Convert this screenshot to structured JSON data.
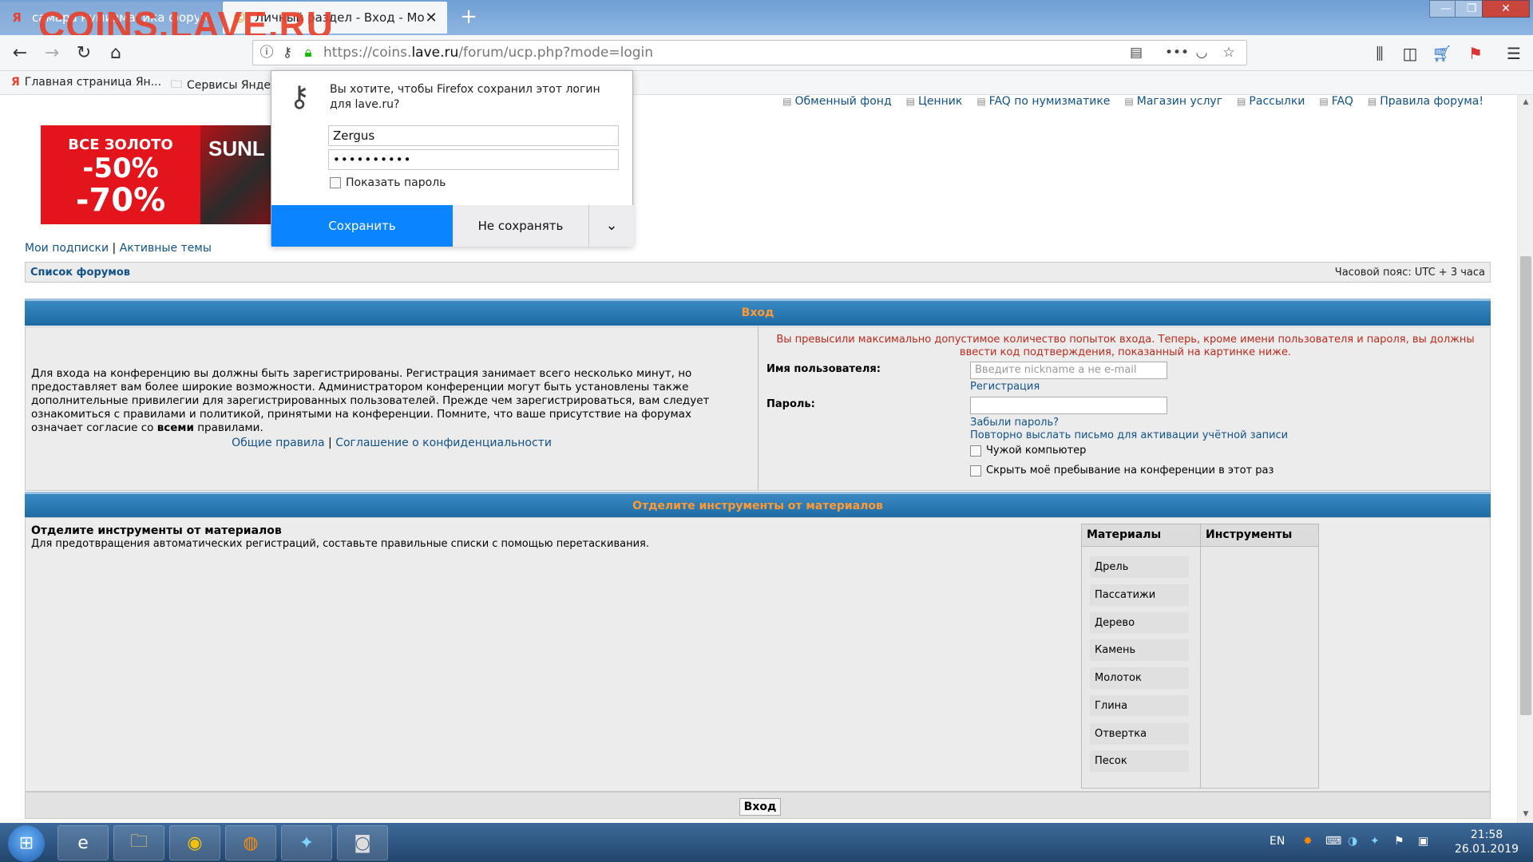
{
  "window": {
    "watermark": "COINS.LAVE.RU",
    "tabs": [
      {
        "label": "самара нумизматика форум",
        "icon": "Я"
      },
      {
        "label": "Личный раздел - Вход - Моне",
        "icon": "☺"
      }
    ],
    "controls": {
      "min": "—",
      "max": "❐",
      "close": "✕"
    }
  },
  "navbar": {
    "url_prefix": "https://coins.",
    "url_host": "lave.ru",
    "url_path": "/forum/ucp.php?mode=login"
  },
  "bookmarks": [
    "Главная страница Ян...",
    "Сервисы Янде"
  ],
  "forum": {
    "top_links": [
      "Обменный фонд",
      "Ценник",
      "FAQ по нумизматике",
      "Магазин услуг",
      "Рассылки",
      "FAQ",
      "Правила форума!"
    ],
    "banner": {
      "line1": "ВСЕ ЗОЛОТО",
      "line2": "-50%",
      "line3": "-70%",
      "brand": "SUNL"
    },
    "sub_links": {
      "subscriptions": "Мои подписки",
      "sep": " | ",
      "active": "Активные темы"
    },
    "breadcrumb": "Список форумов",
    "timezone": "Часовой пояс: UTC + 3 часа",
    "login": {
      "header": "Вход",
      "intro_a": "Для входа на конференцию вы должны быть зарегистрированы. Регистрация занимает всего несколько минут, но предоставляет вам более широкие возможности. Администратором конференции могут быть установлены также дополнительные привилегии для зарегистрированных пользователей. Прежде чем зарегистрироваться, вам следует ознакомиться с правилами и политикой, принятыми на конференции. Помните, что ваше присутствие на форумах означает согласие со ",
      "intro_bold": "всеми",
      "intro_b": " правилами.",
      "rules_link": "Общие правила",
      "rules_sep": " | ",
      "privacy_link": "Соглашение о конфиденциальности",
      "error": "Вы превысили максимально допустимое количество попыток входа. Теперь, кроме имени пользователя и пароля, вы должны ввести код подтверждения, показанный на картинке ниже.",
      "username_label": "Имя пользователя:",
      "username_placeholder": "Введите nickname а не e-mail",
      "register_link": "Регистрация",
      "password_label": "Пароль:",
      "forgot_link": "Забыли пароль?",
      "resend_link": "Повторно выслать письмо для активации учётной записи",
      "foreign_pc": "Чужой компьютер",
      "hide_online": "Скрыть моё пребывание на конференции в этот раз"
    },
    "captcha": {
      "header": "Отделите инструменты от материалов",
      "title": "Отделите инструменты от материалов",
      "desc": "Для предотвращения автоматических регистраций, составьте правильные списки с помощью перетаскивания.",
      "col_materials": "Материалы",
      "col_tools": "Инструменты",
      "items": [
        "Дрель",
        "Пассатижи",
        "Дерево",
        "Камень",
        "Молоток",
        "Глина",
        "Отвертка",
        "Песок"
      ]
    },
    "submit": "Вход"
  },
  "popup": {
    "message": "Вы хотите, чтобы Firefox сохранил этот логин для lave.ru?",
    "username": "Zergus",
    "password": "••••••••••",
    "show_password": "Показать пароль",
    "save": "Сохранить",
    "dont_save": "Не сохранять",
    "dropdown": "⌄"
  },
  "taskbar": {
    "lang": "EN",
    "time": "21:58",
    "date": "26.01.2019"
  }
}
